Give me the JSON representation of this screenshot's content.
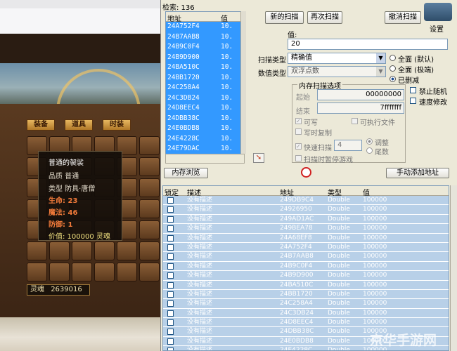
{
  "game": {
    "buttons": [
      "装备",
      "道具",
      "时装"
    ],
    "tooltip": {
      "title": "普通的袈裟",
      "quality": "品质 普通",
      "type": "类型 防具·唐僧",
      "hp": "生命: 23",
      "mp": "魔法: 46",
      "def": "防御: 1",
      "price": "价值: 100000 灵魂"
    },
    "soul_label": "灵魂",
    "soul_value": "2639016"
  },
  "ce": {
    "found_label": "检索: 136",
    "found_headers": {
      "address": "地址",
      "value": "值"
    },
    "found_rows": [
      {
        "address": "24A752F4",
        "value": "10."
      },
      {
        "address": "24B7AAB8",
        "value": "10."
      },
      {
        "address": "24B9C0F4",
        "value": "10."
      },
      {
        "address": "24B9D900",
        "value": "10."
      },
      {
        "address": "24BA510C",
        "value": "10."
      },
      {
        "address": "24BB1720",
        "value": "10."
      },
      {
        "address": "24C258A4",
        "value": "10."
      },
      {
        "address": "24C3DB24",
        "value": "10."
      },
      {
        "address": "24D8EEC4",
        "value": "10."
      },
      {
        "address": "24DBB38C",
        "value": "10."
      },
      {
        "address": "24E0BDB8",
        "value": "10."
      },
      {
        "address": "24E4228C",
        "value": "10."
      },
      {
        "address": "24E79DAC",
        "value": "10."
      }
    ],
    "new_scan": "新的扫描",
    "next_scan": "再次扫描",
    "undo_scan": "撤消扫描",
    "settings": "设置",
    "value_label": "值:",
    "value_input": "20",
    "scan_type_label": "扫描类型",
    "scan_type": "精确值",
    "value_type_label": "数值类型",
    "value_type": "双浮点数",
    "radio_all_default": "全面 (默认)",
    "radio_all_extreme": "全面 (极端)",
    "radio_deleted": "已删减",
    "mem_options_title": "内存扫描选项",
    "start_label": "起始",
    "start_value": "00000000",
    "end_label": "结束",
    "end_value": "7fffffff",
    "writable": "可写",
    "executable": "可执行文件",
    "copy_on_write": "写时复制",
    "fast_scan": "快速扫描",
    "fast_scan_value": "4",
    "align": "调整",
    "last_digits": "尾数",
    "pause_game": "扫描时暂停游戏",
    "no_random": "禁止随机",
    "speedhack": "速度修改",
    "memory_view": "内存浏览",
    "add_address": "手动添加地址",
    "addr_headers": {
      "lock": "锁定",
      "desc": "描述",
      "address": "地址",
      "type": "类型",
      "value": "值"
    },
    "addr_rows": [
      {
        "desc": "没有描述",
        "address": "249DB9C4",
        "type": "Double",
        "value": "100000"
      },
      {
        "desc": "没有描述",
        "address": "24926950",
        "type": "Double",
        "value": "100000"
      },
      {
        "desc": "没有描述",
        "address": "249AD1AC",
        "type": "Double",
        "value": "100000"
      },
      {
        "desc": "没有描述",
        "address": "249BEA78",
        "type": "Double",
        "value": "100000"
      },
      {
        "desc": "没有描述",
        "address": "24A68EF8",
        "type": "Double",
        "value": "100000"
      },
      {
        "desc": "没有描述",
        "address": "24A752F4",
        "type": "Double",
        "value": "100000"
      },
      {
        "desc": "没有描述",
        "address": "24B7AAB8",
        "type": "Double",
        "value": "100000"
      },
      {
        "desc": "没有描述",
        "address": "24B9C0F4",
        "type": "Double",
        "value": "100000"
      },
      {
        "desc": "没有描述",
        "address": "24B9D900",
        "type": "Double",
        "value": "100000"
      },
      {
        "desc": "没有描述",
        "address": "24BA510C",
        "type": "Double",
        "value": "100000"
      },
      {
        "desc": "没有描述",
        "address": "24BB1720",
        "type": "Double",
        "value": "100000"
      },
      {
        "desc": "没有描述",
        "address": "24C258A4",
        "type": "Double",
        "value": "100000"
      },
      {
        "desc": "没有描述",
        "address": "24C3DB24",
        "type": "Double",
        "value": "100000"
      },
      {
        "desc": "没有描述",
        "address": "24D8EEC4",
        "type": "Double",
        "value": "100000"
      },
      {
        "desc": "没有描述",
        "address": "24DBB38C",
        "type": "Double",
        "value": "100000"
      },
      {
        "desc": "没有描述",
        "address": "24E0BDB8",
        "type": "Double",
        "value": "100000"
      },
      {
        "desc": "没有描述",
        "address": "24E4228C",
        "type": "Double",
        "value": "100000"
      }
    ]
  },
  "watermark": "京华手游网"
}
